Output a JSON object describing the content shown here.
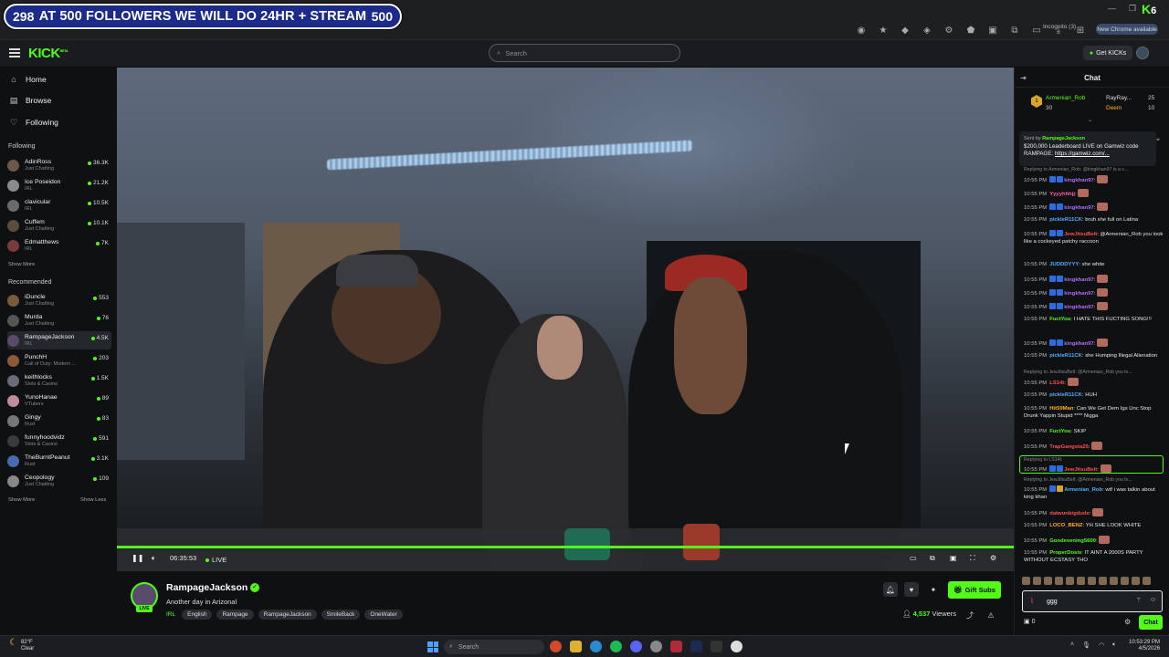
{
  "overlay": {
    "left_count": "298",
    "headline": "AT 500 FOLLOWERS WE WILL DO 24HR + STREAM",
    "right_goal": "500"
  },
  "browser": {
    "incognito": "Incognito (3)",
    "new_chrome": "New Chrome available"
  },
  "header": {
    "logo": "KICK",
    "logo_beta": "BETA",
    "search_placeholder": "Search",
    "get_kicks": "Get KICKs"
  },
  "sidebar": {
    "nav": [
      {
        "label": "Home",
        "icon": "home-icon"
      },
      {
        "label": "Browse",
        "icon": "browse-icon"
      },
      {
        "label": "Following",
        "icon": "heart-icon"
      }
    ],
    "following_heading": "Following",
    "following": [
      {
        "name": "AdinRoss",
        "category": "Just Chatting",
        "viewers": "36.3K"
      },
      {
        "name": "Ice Poseidon",
        "category": "IRL",
        "viewers": "21.2K"
      },
      {
        "name": "clavicular",
        "category": "IRL",
        "viewers": "10.5K"
      },
      {
        "name": "Cuffem",
        "category": "Just Chatting",
        "viewers": "10.1K"
      },
      {
        "name": "Edmatthews",
        "category": "IRL",
        "viewers": "7K"
      }
    ],
    "show_more_following": "Show More",
    "recommended_heading": "Recommended",
    "recommended": [
      {
        "name": "iDuncle",
        "category": "Just Chatting",
        "viewers": "553"
      },
      {
        "name": "Murda",
        "category": "Just Chatting",
        "viewers": "76"
      },
      {
        "name": "RampageJackson",
        "category": "IRL",
        "viewers": "4.5K"
      },
      {
        "name": "PunchH",
        "category": "Call of Duty: Modern ...",
        "viewers": "203"
      },
      {
        "name": "keithlocks",
        "category": "Slots & Casino",
        "viewers": "1.5K"
      },
      {
        "name": "YunoHanae",
        "category": "VTubers",
        "viewers": "89"
      },
      {
        "name": "Gingy",
        "category": "Rust",
        "viewers": "83"
      },
      {
        "name": "funnyhoodvidz",
        "category": "Slots & Casino",
        "viewers": "591"
      },
      {
        "name": "TheBurntPeanut",
        "category": "Rust",
        "viewers": "3.1K"
      },
      {
        "name": "Ceopology",
        "category": "Just Chatting",
        "viewers": "109"
      }
    ],
    "show_more": "Show More",
    "show_less": "Show Less"
  },
  "player": {
    "elapsed": "06:35:53",
    "live": "LIVE"
  },
  "stream": {
    "streamer": "RampageJackson",
    "live_badge": "LIVE",
    "title": "Another day in Arizonal",
    "category": "IRL",
    "tags": [
      "English",
      "Rampage",
      "RampageJackson",
      "SmileBack",
      "OneWater"
    ],
    "gift_subs": "Gift Subs",
    "viewers_count": "4,537",
    "viewers_label": "Viewers"
  },
  "chat": {
    "title": "Chat",
    "top_gifters": [
      {
        "rank": "1",
        "name": "Armenian_Rob",
        "amount": "30"
      },
      {
        "rank": "2",
        "name": "RayRay...",
        "amount": "25"
      },
      {
        "rank": "3",
        "name": "Deem",
        "amount": "10"
      }
    ],
    "pinned": {
      "sent_by_label": "Sent by",
      "sender": "RampageJackson",
      "text": "$200,000 Leaderboard LIVE on Gamwiz code RAMPAGE:",
      "link": "https://gamwiz.com/..."
    },
    "messages": [
      {
        "reply": "Replying to Armenian_Rob: @kingkhan97 is a c...",
        "time": "10:55 PM",
        "user": "kingkhan97",
        "color": "#b36bff",
        "text": ""
      },
      {
        "time": "10:55 PM",
        "user": "Yyyyhhhjj",
        "color": "#ff5fa2",
        "text": ""
      },
      {
        "time": "10:55 PM",
        "user": "kingkhan97",
        "color": "#b36bff",
        "text": ""
      },
      {
        "time": "10:55 PM",
        "user": "pickleR11CK",
        "color": "#4fb0ff",
        "text": "bruh she full on Latina"
      },
      {
        "time": "10:55 PM",
        "user": "JewJitsuBelt",
        "color": "#ff4f4f",
        "text": "@Armenian_Rob you look like a cockeyed patchy raccoon"
      },
      {
        "time": "10:55 PM",
        "user": "JUDDDYYY",
        "color": "#4fb0ff",
        "text": "she white"
      },
      {
        "time": "10:55 PM",
        "user": "kingkhan97",
        "color": "#b36bff",
        "text": ""
      },
      {
        "time": "10:55 PM",
        "user": "kingkhan97",
        "color": "#b36bff",
        "text": ""
      },
      {
        "time": "10:55 PM",
        "user": "kingkhan97",
        "color": "#b36bff",
        "text": ""
      },
      {
        "time": "10:55 PM",
        "user": "FuctYou",
        "color": "#53fc18",
        "text": "I HATE THIS FUCTING SONG!!!"
      },
      {
        "time": "10:55 PM",
        "user": "kingkhan97",
        "color": "#b36bff",
        "text": ""
      },
      {
        "time": "10:55 PM",
        "user": "pickleR11CK",
        "color": "#4fb0ff",
        "text": "she Humping Illegal Alienation"
      },
      {
        "reply": "Replying to JewJitsuBelt: @Armenian_Rob you lo...",
        "time": "10:55 PM",
        "user": "LS14t",
        "color": "#ff4f4f",
        "text": ""
      },
      {
        "time": "10:55 PM",
        "user": "pickleR11CK",
        "color": "#4fb0ff",
        "text": "HUH"
      },
      {
        "time": "10:55 PM",
        "user": "Hit59Man",
        "color": "#ffb020",
        "text": "Can We Get Dem Igs Unc Stop Drunk Yappin Stupid **** Nigga"
      },
      {
        "time": "10:55 PM",
        "user": "FuctYou",
        "color": "#53fc18",
        "text": "SKIP"
      },
      {
        "time": "10:55 PM",
        "user": "TrapGangsta25",
        "color": "#ff4f4f",
        "text": ""
      },
      {
        "reply": "Replying to LS14t:",
        "time": "10:55 PM",
        "user": "JewJitsuBelt",
        "color": "#ff4f4f",
        "text": ""
      },
      {
        "reply": "Replying to JewJitsuBelt: @Armenian_Rob you lo...",
        "time": "10:55 PM",
        "user": "Armenian_Rob",
        "color": "#4fb0ff",
        "text": "wtf i was talkin about king khan"
      },
      {
        "time": "10:55 PM",
        "user": "datwunbigdude",
        "color": "#ff4f4f",
        "text": ""
      },
      {
        "time": "10:55 PM",
        "user": "LOCO_BENZ",
        "color": "#ffb020",
        "text": "YH SHE LOOK WHITE"
      },
      {
        "time": "10:55 PM",
        "user": "Goodevening5600",
        "color": "#53fc18",
        "text": ""
      },
      {
        "time": "10:55 PM",
        "user": "ProperDosis",
        "color": "#53fc18",
        "text": "IT AINT A 2000S PARTY WITHOUT ECSTASY THO"
      }
    ],
    "input_value": "ggg",
    "kick_balance": "0",
    "send_label": "Chat"
  },
  "taskbar": {
    "temp": "82°F",
    "weather": "Clear",
    "search": "Search",
    "time": "10:53:29 PM",
    "date": "4/5/2026"
  },
  "colors": {
    "accent": "#53fc18",
    "bg": "#0e1012",
    "overlay_blue": "#1c2b8a"
  }
}
